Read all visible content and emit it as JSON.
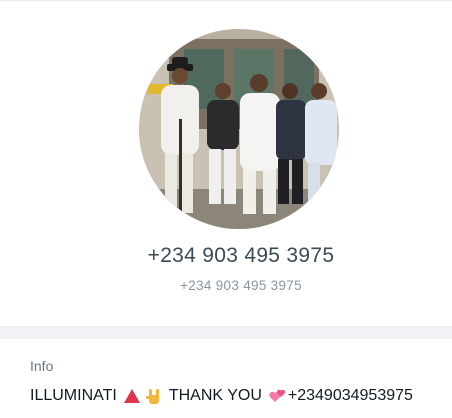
{
  "profile": {
    "phone_primary": "+234 903 495 3975",
    "phone_secondary": "+234 903 495 3975"
  },
  "info": {
    "label": "Info",
    "text_part1": "ILLUMINATI",
    "text_part2": "THANK YOU",
    "text_part3": "+2349034953975",
    "emoji_icons": [
      "red-triangle-icon",
      "rock-on-hand-icon",
      "revolving-hearts-icon"
    ]
  },
  "colors": {
    "primary_text": "#3b4a54",
    "secondary_text": "#8696a0",
    "divider": "#f0f2f5"
  }
}
